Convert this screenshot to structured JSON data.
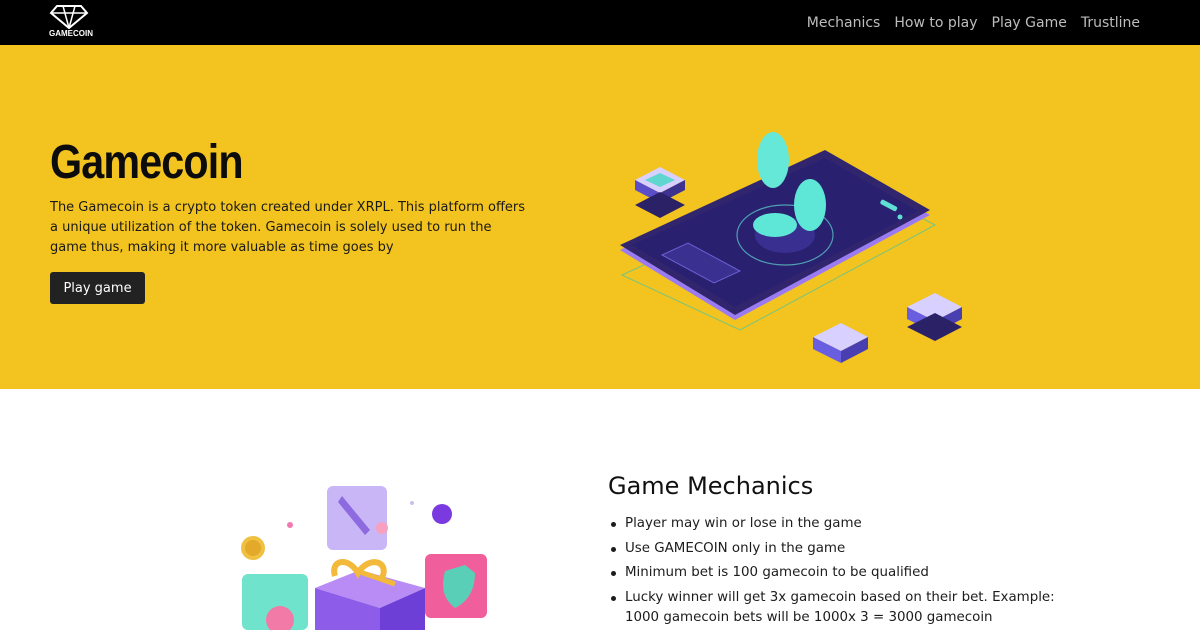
{
  "navbar": {
    "logo_text": "GAMECOIN",
    "links": [
      {
        "label": "Mechanics"
      },
      {
        "label": "How to play"
      },
      {
        "label": "Play Game"
      },
      {
        "label": "Trustline"
      }
    ]
  },
  "hero": {
    "title": "Gamecoin",
    "description": "The Gamecoin is a crypto token created under XRPL. This platform offers a unique utilization of the token. Gamecoin is solely used to run the game thus, making it more valuable as time goes by",
    "button_label": "Play game",
    "background_color": "#f3c31f"
  },
  "mechanics": {
    "title": "Game Mechanics",
    "items": [
      {
        "text": "Player may win or lose in the game"
      },
      {
        "text": "Use GAMECOIN only in the game"
      },
      {
        "text": "Minimum bet is 100 gamecoin to be qualified"
      },
      {
        "text": "Lucky winner will get 3x gamecoin based on their bet. Example: 1000 gamecoin bets will be 1000x 3 = 3000 gamecoin"
      }
    ]
  },
  "icons": [
    "diamond-logo-icon",
    "phone-coin-illustration",
    "gift-box-illustration"
  ]
}
